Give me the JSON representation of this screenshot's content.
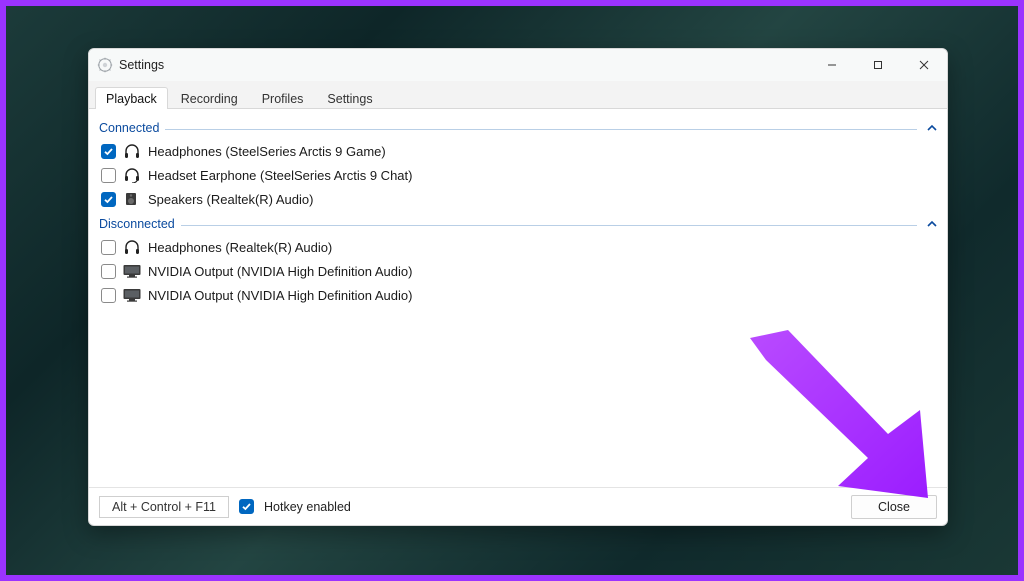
{
  "window": {
    "title": "Settings"
  },
  "tabs": [
    {
      "label": "Playback",
      "active": true
    },
    {
      "label": "Recording",
      "active": false
    },
    {
      "label": "Profiles",
      "active": false
    },
    {
      "label": "Settings",
      "active": false
    }
  ],
  "sections": {
    "connected": {
      "title": "Connected",
      "devices": [
        {
          "checked": true,
          "icon": "headphones",
          "label": "Headphones (SteelSeries Arctis 9 Game)"
        },
        {
          "checked": false,
          "icon": "headset",
          "label": "Headset Earphone (SteelSeries Arctis 9 Chat)"
        },
        {
          "checked": true,
          "icon": "speaker",
          "label": "Speakers (Realtek(R) Audio)"
        }
      ]
    },
    "disconnected": {
      "title": "Disconnected",
      "devices": [
        {
          "checked": false,
          "icon": "headphones",
          "label": "Headphones (Realtek(R) Audio)"
        },
        {
          "checked": false,
          "icon": "monitor",
          "label": "NVIDIA Output (NVIDIA High Definition Audio)"
        },
        {
          "checked": false,
          "icon": "monitor",
          "label": "NVIDIA Output (NVIDIA High Definition Audio)"
        }
      ]
    }
  },
  "footer": {
    "hotkey_text": "Alt + Control + F11",
    "hotkey_enabled_label": "Hotkey enabled",
    "close_label": "Close"
  }
}
